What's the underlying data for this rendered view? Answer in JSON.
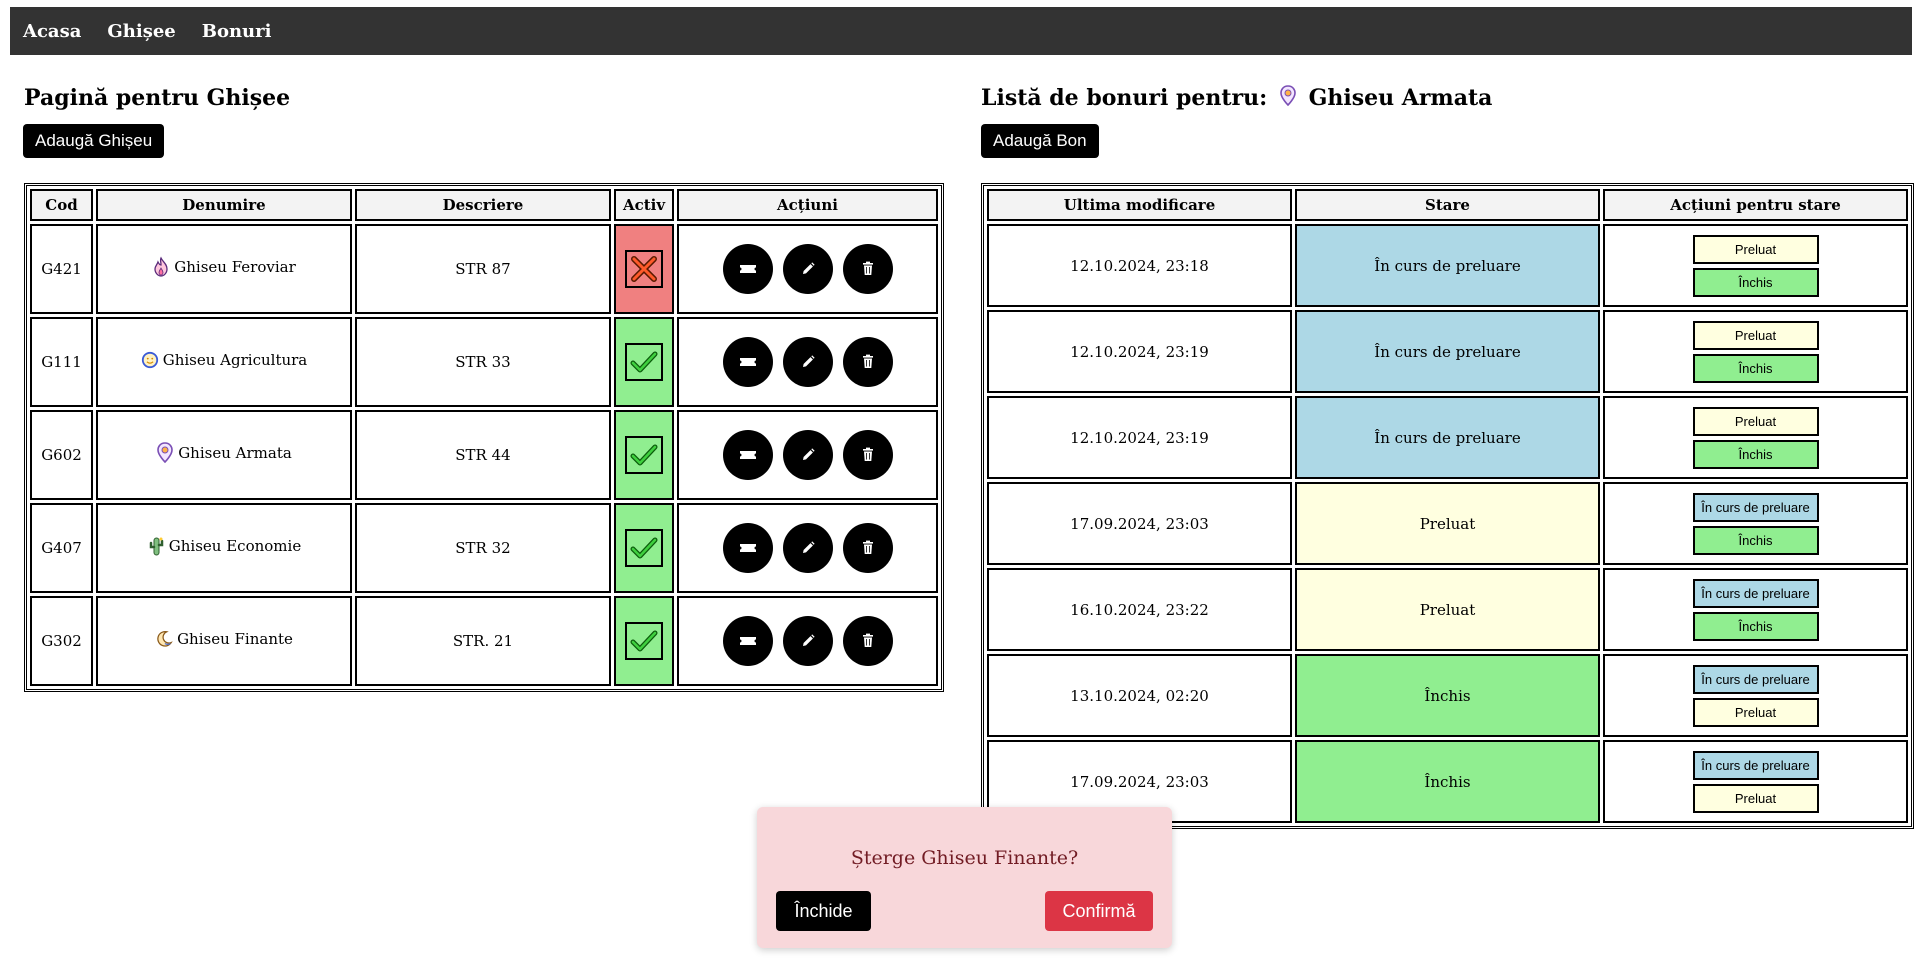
{
  "nav": {
    "items": [
      "Acasa",
      "Ghișee",
      "Bonuri"
    ]
  },
  "ghisee": {
    "title": "Pagină pentru Ghișee",
    "add_button": "Adaugă Ghișeu",
    "headers": [
      "Cod",
      "Denumire",
      "Descriere",
      "Activ",
      "Acțiuni"
    ],
    "rows": [
      {
        "cod": "G421",
        "denumire": "Ghiseu Feroviar",
        "icon": "flame-icon",
        "descriere": "STR 87",
        "activ": false
      },
      {
        "cod": "G111",
        "denumire": "Ghiseu Agricultura",
        "icon": "smiley-icon",
        "descriere": "STR 33",
        "activ": true
      },
      {
        "cod": "G602",
        "denumire": "Ghiseu Armata",
        "icon": "location-pin-icon",
        "descriere": "STR 44",
        "activ": true
      },
      {
        "cod": "G407",
        "denumire": "Ghiseu Economie",
        "icon": "cactus-icon",
        "descriere": "STR 32",
        "activ": true
      },
      {
        "cod": "G302",
        "denumire": "Ghiseu Finante",
        "icon": "moon-icon",
        "descriere": "STR. 21",
        "activ": true
      }
    ],
    "action_icons": [
      "ticket-icon",
      "pencil-icon",
      "trash-icon"
    ]
  },
  "bonuri": {
    "title_prefix": "Listă de bonuri pentru:",
    "ghiseu_name": "Ghiseu Armata",
    "ghiseu_icon": "location-pin-icon",
    "add_button": "Adaugă Bon",
    "headers": [
      "Ultima modificare",
      "Stare",
      "Acțiuni pentru stare"
    ],
    "rows": [
      {
        "data": "12.10.2024, 23:18",
        "stare": "În curs de preluare",
        "stare_key": "curs",
        "actions": [
          {
            "label": "Preluat",
            "key": "preluat"
          },
          {
            "label": "Închis",
            "key": "inchis"
          }
        ]
      },
      {
        "data": "12.10.2024, 23:19",
        "stare": "În curs de preluare",
        "stare_key": "curs",
        "actions": [
          {
            "label": "Preluat",
            "key": "preluat"
          },
          {
            "label": "Închis",
            "key": "inchis"
          }
        ]
      },
      {
        "data": "12.10.2024, 23:19",
        "stare": "În curs de preluare",
        "stare_key": "curs",
        "actions": [
          {
            "label": "Preluat",
            "key": "preluat"
          },
          {
            "label": "Închis",
            "key": "inchis"
          }
        ]
      },
      {
        "data": "17.09.2024, 23:03",
        "stare": "Preluat",
        "stare_key": "preluat",
        "actions": [
          {
            "label": "În curs de preluare",
            "key": "curs"
          },
          {
            "label": "Închis",
            "key": "inchis"
          }
        ]
      },
      {
        "data": "16.10.2024, 23:22",
        "stare": "Preluat",
        "stare_key": "preluat",
        "actions": [
          {
            "label": "În curs de preluare",
            "key": "curs"
          },
          {
            "label": "Închis",
            "key": "inchis"
          }
        ]
      },
      {
        "data": "13.10.2024, 02:20",
        "stare": "Închis",
        "stare_key": "inchis",
        "actions": [
          {
            "label": "În curs de preluare",
            "key": "curs"
          },
          {
            "label": "Preluat",
            "key": "preluat"
          }
        ]
      },
      {
        "data": "17.09.2024, 23:03",
        "stare": "Închis",
        "stare_key": "inchis",
        "actions": [
          {
            "label": "În curs de preluare",
            "key": "curs"
          },
          {
            "label": "Preluat",
            "key": "preluat"
          }
        ]
      }
    ]
  },
  "modal": {
    "message": "Șterge Ghiseu Finante?",
    "close_label": "Închide",
    "confirm_label": "Confirmă"
  },
  "colors": {
    "navbar": "#333333",
    "activ_ok": "#90ee90",
    "activ_no": "#f08080",
    "stare_curs": "#add8e6",
    "stare_preluat": "#ffffe0",
    "stare_inchis": "#90ee90",
    "modal_bg": "#f8d7da",
    "confirm": "#dc3545"
  }
}
